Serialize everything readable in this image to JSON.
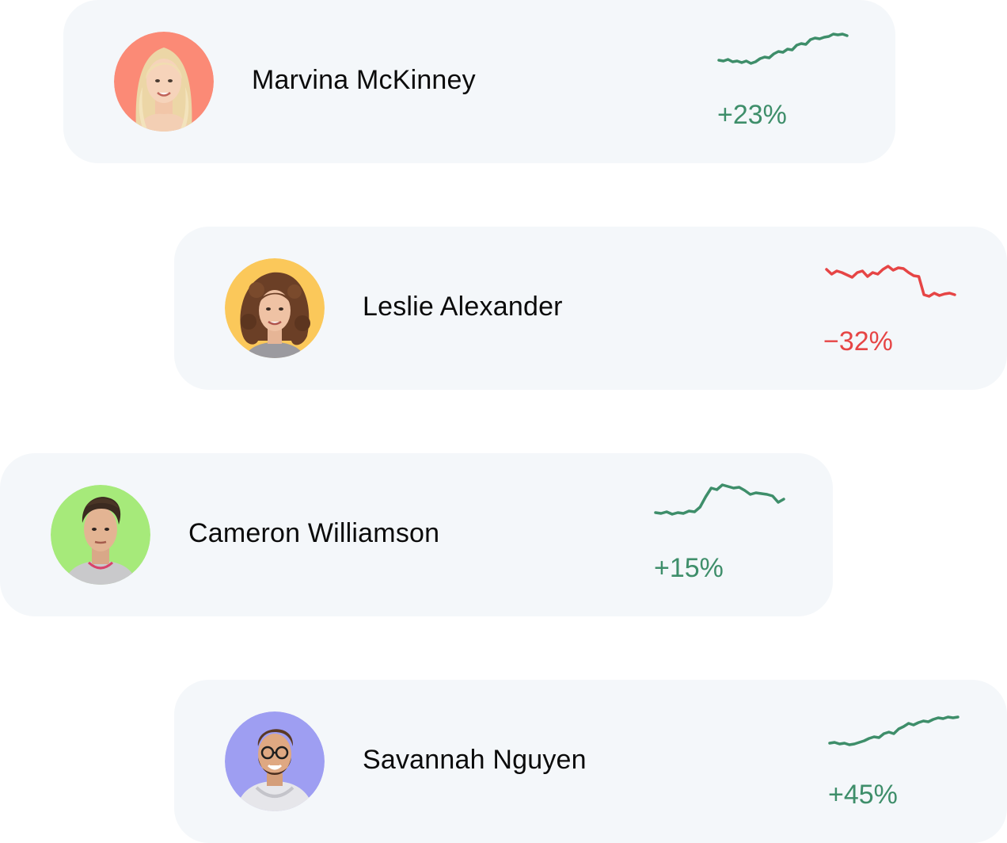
{
  "colors": {
    "card_bg": "#f4f7fa",
    "positive": "#3e8e6a",
    "negative": "#e64545",
    "name_text": "#0b0b0b"
  },
  "people": [
    {
      "name": "Marvina McKinney",
      "change": "+23%",
      "trend": "up",
      "avatar_bg": "#fb8a76",
      "avatar_icon": "person-photo-blonde-woman",
      "sparkline": [
        34,
        33,
        35,
        32,
        33,
        31,
        33,
        30,
        32,
        36,
        38,
        37,
        42,
        45,
        44,
        48,
        47,
        53,
        55,
        54,
        60,
        62,
        61,
        63,
        64,
        67,
        66,
        67,
        65
      ]
    },
    {
      "name": "Leslie Alexander",
      "change": "−32%",
      "trend": "down",
      "avatar_bg": "#fbc85a",
      "avatar_icon": "person-photo-curly-hair-woman",
      "sparkline": [
        56,
        50,
        54,
        52,
        49,
        46,
        52,
        54,
        47,
        52,
        50,
        56,
        60,
        55,
        58,
        57,
        52,
        48,
        47,
        24,
        22,
        26,
        23,
        25,
        26,
        24
      ]
    },
    {
      "name": "Cameron Williamson",
      "change": "+15%",
      "trend": "up",
      "avatar_bg": "#a6ea7a",
      "avatar_icon": "person-photo-man",
      "sparkline": [
        35,
        34,
        36,
        33,
        35,
        34,
        37,
        36,
        42,
        55,
        66,
        64,
        70,
        68,
        66,
        67,
        63,
        58,
        60,
        59,
        58,
        56,
        48,
        52
      ]
    },
    {
      "name": "Savannah Nguyen",
      "change": "+45%",
      "trend": "up",
      "avatar_bg": "#9e9ef2",
      "avatar_icon": "person-photo-man-glasses",
      "sparkline": [
        30,
        31,
        29,
        30,
        28,
        29,
        31,
        33,
        36,
        38,
        37,
        42,
        44,
        42,
        48,
        51,
        55,
        53,
        56,
        58,
        57,
        60,
        62,
        61,
        63,
        62,
        63
      ]
    }
  ]
}
